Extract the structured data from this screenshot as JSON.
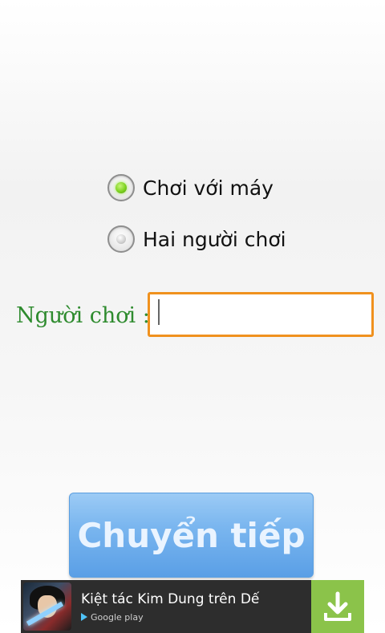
{
  "game_mode": {
    "options": [
      {
        "label": "Chơi với máy",
        "selected": true
      },
      {
        "label": "Hai người chơi",
        "selected": false
      }
    ]
  },
  "player": {
    "label": "Người chơi :",
    "value": ""
  },
  "continue_button": {
    "label": "Chuyển tiếp"
  },
  "ad": {
    "title": "Kiệt tác Kim Dung trên Dế",
    "source": "Google play",
    "icons": {
      "thumbnail": "game-character-thumbnail",
      "source": "google-play-icon",
      "action": "download-icon"
    }
  },
  "colors": {
    "radio_selected": "#7ed321",
    "player_label": "#2e8b2e",
    "input_border": "#f0911e",
    "button_bg": "#7ab6ef",
    "ad_bg": "#2d2d2d",
    "ad_download_bg": "#8bc34a"
  }
}
